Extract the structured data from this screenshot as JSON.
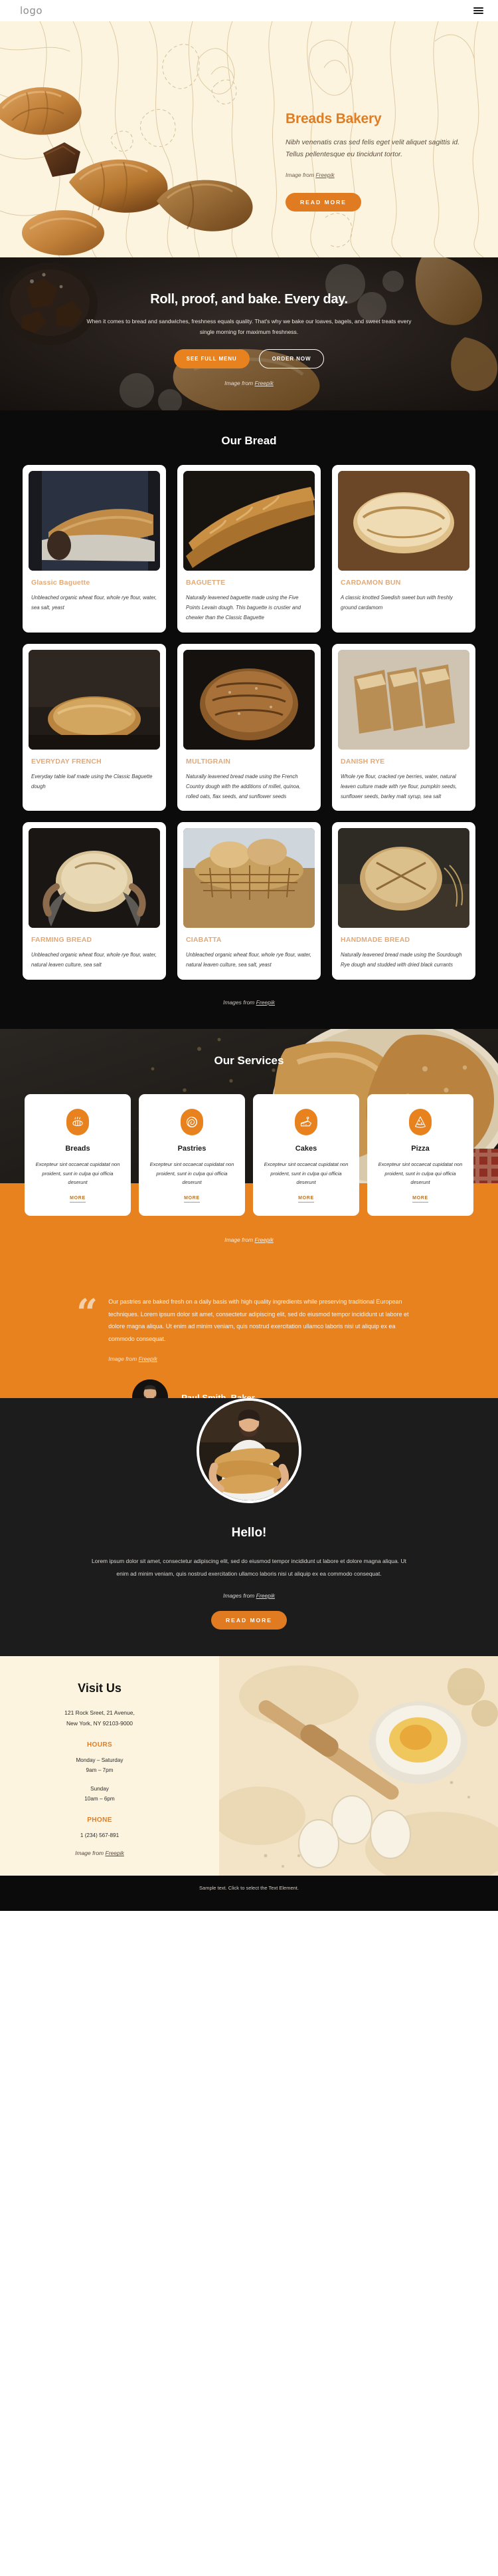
{
  "header": {
    "logo": "logo",
    "menu_icon": "hamburger-menu-icon"
  },
  "hero_cream": {
    "title": "Breads Bakery",
    "description": "Nibh venenatis cras sed felis eget velit aliquet sagittis id. Tellus pellentesque eu tincidunt tortor.",
    "credit_prefix": "Image from ",
    "credit_link": "Freepik",
    "button": "READ MORE"
  },
  "hero_dark": {
    "title": "Roll, proof, and bake. Every day.",
    "description": "When it comes to bread and sandwiches, freshness equals quality. That's why we bake our loaves, bagels, and sweet treats every single morning for maximum freshness.",
    "primary_button": "SEE FULL MENU",
    "secondary_button": "ORDER NOW",
    "credit_prefix": "Image from ",
    "credit_link": "Freepik"
  },
  "bread": {
    "title": "Our Bread",
    "credit_prefix": "Images from ",
    "credit_link": "Freepik",
    "cards": [
      {
        "title": "Glassic Baguette",
        "text": "Unbleached organic wheat flour, whole rye flour, water, sea salt, yeast"
      },
      {
        "title": "BAGUETTE",
        "text": "Naturally leavened baguette made using the Five Points Levain dough. This baguette is crustier and chewier than the Classic Baguette"
      },
      {
        "title": "CARDAMON BUN",
        "text": "A classic knotted Swedish sweet bun with freshly ground cardamom"
      },
      {
        "title": "EVERYDAY FRENCH",
        "text": "Everyday table loaf made using the Classic Baguette dough"
      },
      {
        "title": "MULTIGRAIN",
        "text": "Naturally leavened bread made using the French Country dough with the additions of millet, quinoa, rolled oats, flax seeds, and sunflower seeds"
      },
      {
        "title": "DANISH RYE",
        "text": "Whole rye flour, cracked rye berries, water, natural leaven culture made with rye flour, pumpkin seeds, sunflower seeds, barley malt syrup, sea salt"
      },
      {
        "title": "FARMING BREAD",
        "text": "Unbleached organic wheat flour, whole rye flour, water, natural leaven culture, sea salt"
      },
      {
        "title": "CIABATTA",
        "text": "Unbleached organic wheat flour, whole rye flour, water, natural leaven culture, sea salt, yeast"
      },
      {
        "title": "HANDMADE BREAD",
        "text": "Naturally leavened bread made using the Sourdough Rye dough and studded with dried black currants"
      }
    ]
  },
  "services": {
    "title": "Our Services",
    "credit_prefix": "Image from ",
    "credit_link": "Freepik",
    "cards": [
      {
        "icon": "bread-loaf-icon",
        "title": "Breads",
        "text": "Excepteur sint occaecat cupidatat non proident, sunt in culpa qui officia deserunt",
        "more": "MORE"
      },
      {
        "icon": "pastry-swirl-icon",
        "title": "Pastries",
        "text": "Excepteur sint occaecat cupidatat non proident, sunt in culpa qui officia deserunt",
        "more": "MORE"
      },
      {
        "icon": "cake-slice-icon",
        "title": "Cakes",
        "text": "Excepteur sint occaecat cupidatat non proident, sunt in culpa qui officia deserunt",
        "more": "MORE"
      },
      {
        "icon": "pizza-slice-icon",
        "title": "Pizza",
        "text": "Excepteur sint occaecat cupidatat non proident, sunt in culpa qui officia deserunt",
        "more": "MORE"
      }
    ]
  },
  "testimonial": {
    "quote": "Our pastries are baked fresh on a daily basis with high quality ingredients while preserving traditional European techniques. Lorem ipsum dolor sit amet, consectetur adipiscing elit, sed do eiusmod tempor incididunt ut labore et dolore magna aliqua. Ut enim ad minim veniam, quis nostrud exercitation ullamco laboris nisi ut aliquip ex ea commodo consequat.",
    "credit_prefix": "Image from ",
    "credit_link": "Freepik",
    "author": "Paul Smith, Baker"
  },
  "hello": {
    "title": "Hello!",
    "text": "Lorem ipsum dolor sit amet, consectetur adipiscing elit, sed do eiusmod tempor incididunt ut labore et dolore magna aliqua. Ut enim ad minim veniam, quis nostrud exercitation ullamco laboris nisi ut aliquip ex ea commodo consequat.",
    "credit_prefix": "Images from ",
    "credit_link": "Freepik",
    "button": "READ MORE"
  },
  "visit": {
    "title": "Visit Us",
    "address_line1": "121 Rock Sreet, 21 Avenue,",
    "address_line2": "New York, NY 92103-9000",
    "hours_label": "HOURS",
    "hours_line1": "Monday – Saturday",
    "hours_line2": "9am – 7pm",
    "hours_line3": "Sunday",
    "hours_line4": "10am – 6pm",
    "phone_label": "PHONE",
    "phone_value": "1 (234) 567-891",
    "credit_prefix": "Image from ",
    "credit_link": "Freepik"
  },
  "bottom": {
    "text": "Sample text. Click to select the Text Element."
  },
  "colors": {
    "accent": "#e8821f",
    "accent_dark": "#dd7e26",
    "cream": "#fdf4e0",
    "dark": "#0b0b0b",
    "card_title": "#e2a977"
  }
}
